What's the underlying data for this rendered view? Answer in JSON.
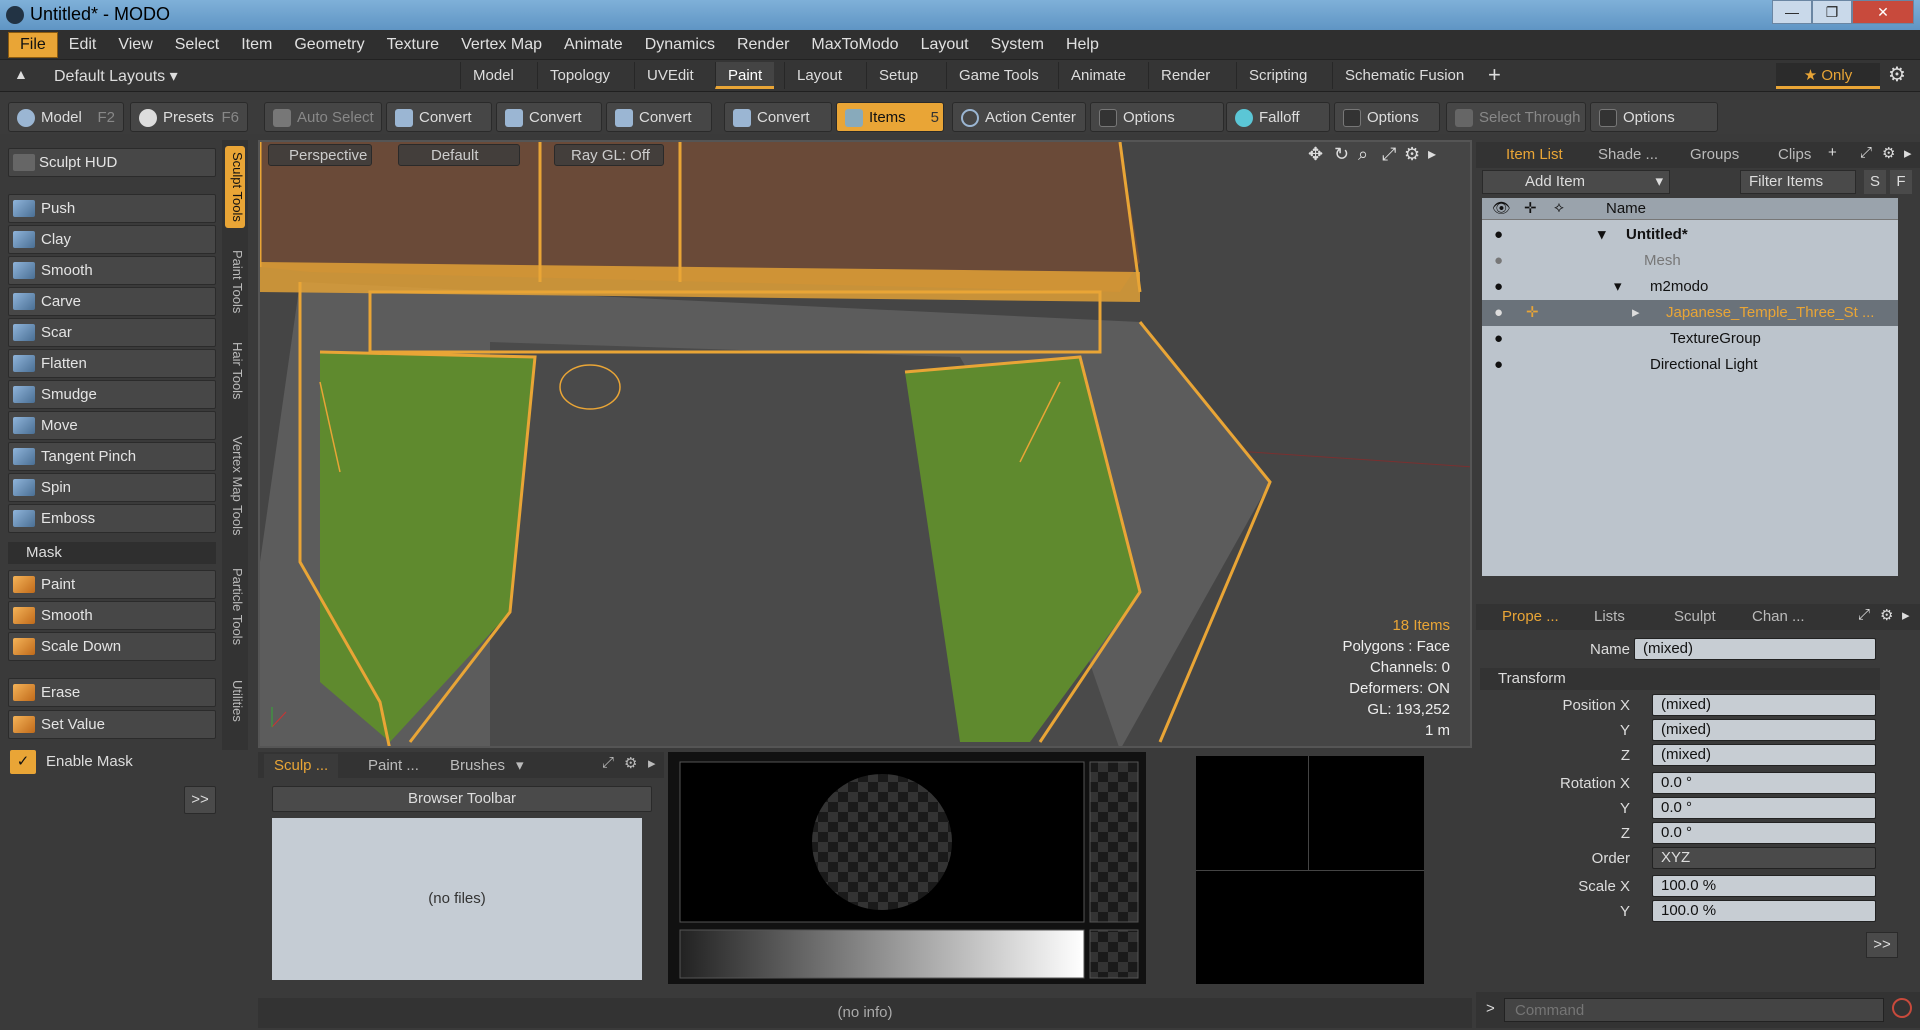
{
  "window": {
    "title": "Untitled* - MODO",
    "controls": [
      "—",
      "❐",
      "✕"
    ]
  },
  "menu": {
    "items": [
      "File",
      "Edit",
      "View",
      "Select",
      "Item",
      "Geometry",
      "Texture",
      "Vertex Map",
      "Animate",
      "Dynamics",
      "Render",
      "MaxToModo",
      "Layout",
      "System",
      "Help"
    ]
  },
  "layouts": {
    "default_label": "Default Layouts ▾",
    "tabs": [
      "Model",
      "Topology",
      "UVEdit",
      "Paint",
      "Layout",
      "Setup",
      "Game Tools",
      "Animate",
      "Render",
      "Scripting",
      "Schematic Fusion"
    ],
    "add": "+",
    "only_label": "★  Only"
  },
  "toolbar": {
    "model_label": "Model",
    "model_key": "F2",
    "presets_label": "Presets",
    "presets_key": "F6",
    "auto_select": "Auto Select",
    "convert": "Convert",
    "items": "Items",
    "items_count": "5",
    "action_center": "Action Center",
    "options": "Options",
    "falloff": "Falloff",
    "select_through": "Select Through"
  },
  "left": {
    "hud": "Sculpt HUD",
    "tools": [
      "Push",
      "Clay",
      "Smooth",
      "Carve",
      "Scar",
      "Flatten",
      "Smudge",
      "Move",
      "Tangent Pinch",
      "Spin",
      "Emboss"
    ],
    "mask_header": "Mask",
    "mask_tools": [
      "Paint",
      "Smooth",
      "Scale Down"
    ],
    "erase": "Erase",
    "set_value": "Set Value",
    "enable_mask": "Enable Mask",
    "more": ">>"
  },
  "vtabs": [
    "Sculpt Tools",
    "Paint Tools",
    "Hair Tools",
    "Vertex Map Tools",
    "Particle Tools",
    "Utilities"
  ],
  "viewport": {
    "view": "Perspective",
    "style": "Default",
    "raygl": "Ray GL: Off",
    "items": "18 Items",
    "polygons": "Polygons : Face",
    "channels": "Channels: 0",
    "deformers": "Deformers: ON",
    "gl": "GL: 193,252",
    "scale": "1 m"
  },
  "browser": {
    "tabs": [
      "Sculp ...",
      "Paint ...",
      "Brushes"
    ],
    "toolbar": "Browser Toolbar",
    "empty": "(no files)"
  },
  "status": {
    "info": "(no info)"
  },
  "itemlist": {
    "tabs": [
      "Item List",
      "Shade ...",
      "Groups",
      "Clips"
    ],
    "add_item": "Add Item",
    "filter": "Filter Items",
    "col_name": "Name",
    "rows": [
      {
        "label": "Untitled*",
        "indent": 0
      },
      {
        "label": "Mesh",
        "indent": 1
      },
      {
        "label": "m2modo",
        "indent": 1
      },
      {
        "label": "Japanese_Temple_Three_St ...",
        "indent": 2
      },
      {
        "label": "TextureGroup",
        "indent": 2
      },
      {
        "label": "Directional Light",
        "indent": 1
      }
    ]
  },
  "props": {
    "tabs": [
      "Prope ...",
      "Lists",
      "Sculpt",
      "Chan ..."
    ],
    "name_label": "Name",
    "name_value": "(mixed)",
    "transform": "Transform",
    "pos_label": "Position X",
    "y": "Y",
    "z": "Z",
    "mixed": "(mixed)",
    "rot_label": "Rotation X",
    "deg": "0.0 °",
    "order_label": "Order",
    "order": "XYZ",
    "scale_label": "Scale X",
    "scale": "100.0 %",
    "more": ">>"
  },
  "command": {
    "placeholder": "Command",
    "prompt": ">"
  },
  "colors": {
    "accent": "#e9a536"
  }
}
